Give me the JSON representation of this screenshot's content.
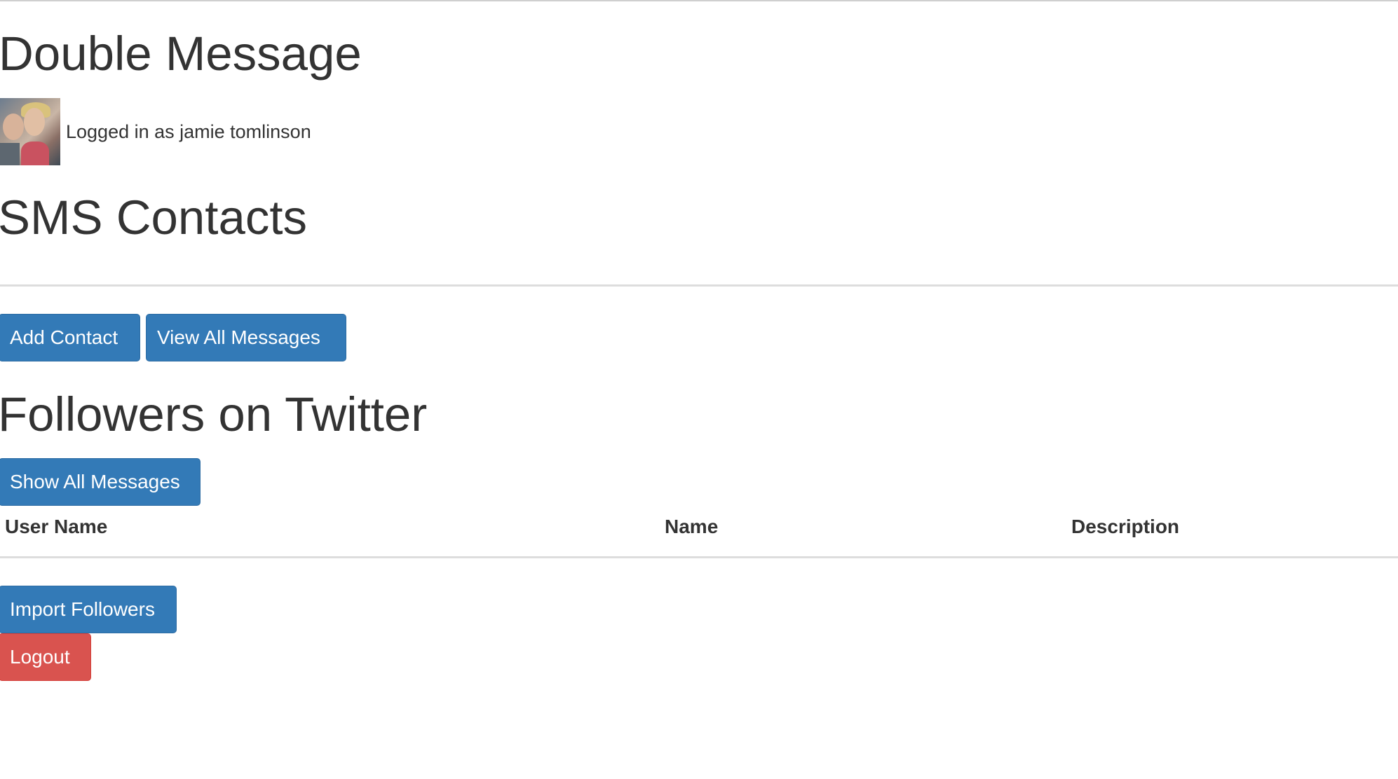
{
  "app": {
    "title": "Double Message"
  },
  "user": {
    "avatar_alt": "profile photo",
    "logged_in_text": "Logged in as jamie tomlinson"
  },
  "sms_contacts": {
    "title": "SMS Contacts",
    "add_contact_label": "Add Contact",
    "view_all_messages_label": "View All Messages"
  },
  "twitter": {
    "title": "Followers on Twitter",
    "show_all_messages_label": "Show All Messages",
    "table": {
      "columns": [
        "User Name",
        "Name",
        "Description"
      ],
      "rows": []
    },
    "import_followers_label": "Import Followers"
  },
  "session": {
    "logout_label": "Logout"
  },
  "colors": {
    "primary": "#337ab7",
    "danger": "#d9534f",
    "text": "#333333",
    "rule": "#dddddd"
  }
}
